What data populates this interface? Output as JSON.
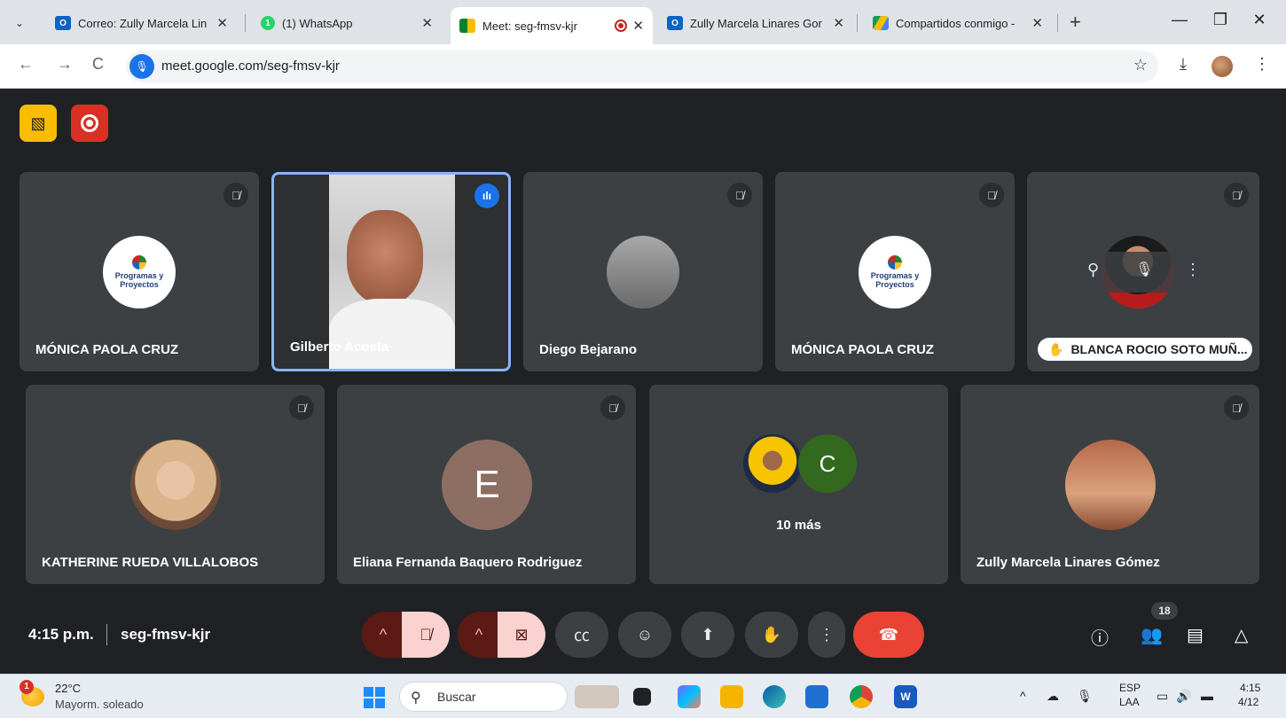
{
  "browser": {
    "tabs": [
      {
        "title": "Correo: Zully Marcela Lin",
        "favicon": "outlook-icon"
      },
      {
        "title": "(1) WhatsApp",
        "favicon": "whatsapp-icon",
        "badge": "1"
      },
      {
        "title": "Meet: seg-fmsv-kjr",
        "favicon": "meet-icon",
        "active": true
      },
      {
        "title": "Zully Marcela Linares Gor",
        "favicon": "outlook-icon"
      },
      {
        "title": "Compartidos conmigo - ",
        "favicon": "drive-icon"
      }
    ],
    "url": "meet.google.com/seg-fmsv-kjr"
  },
  "meet": {
    "tiles_row1": [
      {
        "name": "MÓNICA PAOLA CRUZ",
        "avatar": "banco-programas-logo"
      },
      {
        "name": "Gilberto Acosta",
        "video": true,
        "speaking": true
      },
      {
        "name": "Diego Bejarano",
        "avatar": "photo"
      },
      {
        "name": "MÓNICA PAOLA CRUZ",
        "avatar": "banco-programas-logo"
      },
      {
        "name": "BLANCA ROCIO SOTO MUÑ...",
        "hand_raised": true
      }
    ],
    "tiles_row2": [
      {
        "name": "KATHERINE RUEDA VILLALOBOS",
        "avatar": "photo"
      },
      {
        "name": "Eliana Fernanda Baquero Rodriguez",
        "initial": "E"
      },
      {
        "name": "10 más",
        "initial": "C"
      },
      {
        "name": "Zully Marcela Linares Gómez",
        "avatar": "photo"
      }
    ],
    "logo_text": {
      "line1": "Programas y",
      "line2": "Proyectos"
    },
    "clock": "4:15 p.m.",
    "meeting_code": "seg-fmsv-kjr",
    "people_count": "18",
    "colors": {
      "accent_blue": "#8ab4f8",
      "hangup_red": "#ea4335",
      "tile_bg": "#3c4043"
    }
  },
  "taskbar": {
    "weather_temp": "22°C",
    "weather_desc": "Mayorm. soleado",
    "weather_badge": "1",
    "search_label": "Buscar",
    "lang_line1": "ESP",
    "lang_line2": "LAA",
    "time": "4:15",
    "date": "4/12"
  }
}
